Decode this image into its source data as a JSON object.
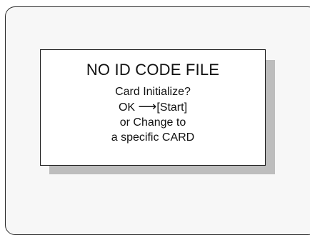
{
  "dialog": {
    "title": "NO ID CODE FILE",
    "line1": "Card Initialize?",
    "ok_label": "OK",
    "arrow_glyph": "⟶",
    "start_label": "[Start]",
    "line3": "or Change to",
    "line4": "a specific CARD"
  }
}
